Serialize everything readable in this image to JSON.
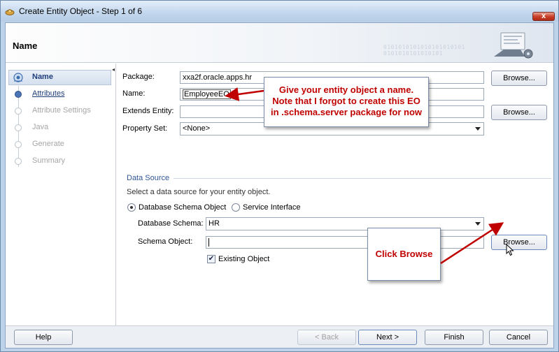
{
  "window": {
    "title": "Create Entity Object - Step 1 of 6",
    "close_label": "x"
  },
  "header": {
    "title": "Name",
    "binary_decoration": "0101010101010101010101\n0101010101010101"
  },
  "nav": {
    "items": [
      {
        "label": "Name",
        "state": "current"
      },
      {
        "label": "Attributes",
        "state": "link"
      },
      {
        "label": "Attribute Settings",
        "state": "disabled"
      },
      {
        "label": "Java",
        "state": "disabled"
      },
      {
        "label": "Generate",
        "state": "disabled"
      },
      {
        "label": "Summary",
        "state": "disabled"
      }
    ]
  },
  "form": {
    "package_label": "Package:",
    "package_value": "xxa2f.oracle.apps.hr",
    "name_label": "Name:",
    "name_value": "EmployeeEO",
    "extends_label": "Extends Entity:",
    "extends_value": "",
    "property_set_label": "Property Set:",
    "property_set_value": "<None>",
    "browse_label": "Browse...",
    "data_source": {
      "title": "Data Source",
      "description": "Select a data source for your entity object.",
      "radio_db": "Database Schema Object",
      "radio_service": "Service Interface",
      "selected": "Database Schema Object",
      "schema_label": "Database Schema:",
      "schema_value": "HR",
      "schema_object_label": "Schema Object:",
      "schema_object_value": "",
      "existing_label": "Existing Object",
      "existing_checked": true
    }
  },
  "callouts": {
    "name_tip": "Give your entity object a name.\nNote that I forgot to create this EO\nin .schema.server package for now",
    "browse_tip": "Click Browse"
  },
  "footer": {
    "help": "Help",
    "back": "< Back",
    "next": "Next >",
    "finish": "Finish",
    "cancel": "Cancel"
  },
  "colors": {
    "callout_text": "#c00000",
    "arrow": "#c00000",
    "link": "#1f3d7a",
    "section": "#2f5597"
  }
}
